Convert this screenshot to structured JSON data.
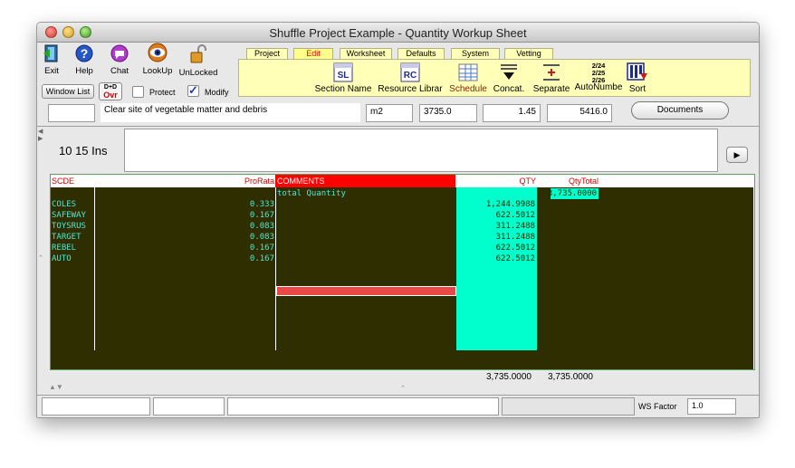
{
  "window": {
    "title": "Shuffle Project Example - Quantity Workup Sheet"
  },
  "toolbar": {
    "exit": "Exit",
    "help": "Help",
    "chat": "Chat",
    "lookup": "LookUp",
    "unlocked": "UnLocked",
    "window_list": "Window List",
    "dnd_top": "D+D",
    "dnd_bottom": "Ovr",
    "protect": "Protect",
    "modify": "Modify"
  },
  "tabs": [
    "Project",
    "Edit",
    "Worksheet",
    "Defaults",
    "System",
    "Vetting"
  ],
  "panel_tools": {
    "section_name": "Section Name",
    "section_icon": "SL",
    "resource_library": "Resource Librar",
    "resource_icon": "RC",
    "schedule": "Schedule",
    "concat": "Concat.",
    "separate": "Separate",
    "autonumber": "AutoNumbe",
    "auto_lines": [
      "2/24",
      "2/25",
      "2/26"
    ],
    "sort": "Sort"
  },
  "item": {
    "code": "",
    "description": "Clear site of vegetable matter and debris",
    "unit": "m2",
    "quantity": "3735.0",
    "rate": "1.45",
    "total": "5416.0",
    "documents": "Documents"
  },
  "memo": {
    "label": "10 15 Ins",
    "text": ""
  },
  "grid": {
    "headers": {
      "scde": "SCDE",
      "prorata": "ProRata",
      "comments": "COMMENTS",
      "qty": "QTY",
      "qtytotal": "QtyTotal"
    },
    "summary": {
      "comment": "total Quantity",
      "qtytotal": "3,735.0000"
    },
    "rows": [
      {
        "scde": "COLES",
        "prorata": "0.333",
        "qty": "1,244.9988"
      },
      {
        "scde": "SAFEWAY",
        "prorata": "0.167",
        "qty": "622.5012"
      },
      {
        "scde": "TOYSRUS",
        "prorata": "0.083",
        "qty": "311.2488"
      },
      {
        "scde": "TARGET",
        "prorata": "0.083",
        "qty": "311.2488"
      },
      {
        "scde": "REBEL",
        "prorata": "0.167",
        "qty": "622.5012"
      },
      {
        "scde": "AUTO",
        "prorata": "0.167",
        "qty": "622.5012"
      }
    ],
    "totals": {
      "qty": "3,735.0000",
      "qtytotal": "3,735.0000"
    }
  },
  "status": {
    "ws_factor_label": "WS Factor",
    "ws_factor": "1.0"
  },
  "colors": {
    "dark_bg": "#2e2e00",
    "cyan": "#00ffcc",
    "header_red": "#ff0000",
    "text_cyan": "#4fe6d6"
  }
}
